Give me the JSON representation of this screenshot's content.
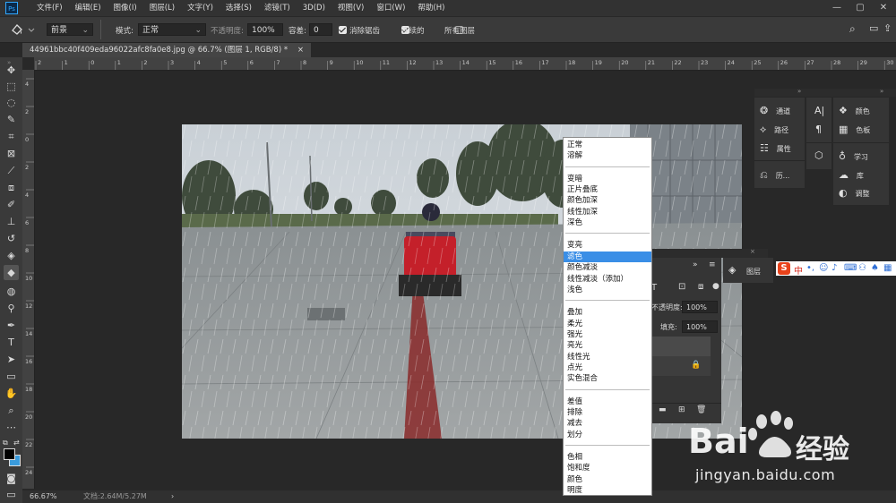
{
  "app": {
    "logo": "Ps",
    "menus": [
      "文件(F)",
      "编辑(E)",
      "图像(I)",
      "图层(L)",
      "文字(Y)",
      "选择(S)",
      "滤镜(T)",
      "3D(D)",
      "视图(V)",
      "窗口(W)",
      "帮助(H)"
    ],
    "window_controls": [
      "—",
      "▢",
      "✕"
    ]
  },
  "options_bar": {
    "fill_source": "前景",
    "mode_label": "模式:",
    "mode_value": "正常",
    "opacity_label": "不透明度:",
    "opacity_value": "100%",
    "tolerance_label": "容差:",
    "tolerance_value": "0",
    "antialias_label": "消除锯齿",
    "antialias_checked": true,
    "contiguous_label": "连续的",
    "contiguous_checked": true,
    "all_layers_label": "所有图层",
    "all_layers_checked": false
  },
  "document_tab": {
    "title": "44961bbc40f409eda96022afc8fa0e8.jpg @ 66.7% (图层 1, RGB/8) *",
    "close": "×"
  },
  "ruler": {
    "top_ticks": [
      "2",
      "1",
      "0",
      "1",
      "2",
      "3",
      "4",
      "5",
      "6",
      "7",
      "8",
      "9",
      "10",
      "11",
      "12",
      "13",
      "14",
      "15",
      "16",
      "17",
      "18",
      "19",
      "20",
      "21",
      "22",
      "23",
      "24",
      "25",
      "26",
      "27",
      "28",
      "29",
      "30"
    ],
    "left_ticks": [
      "4",
      "2",
      "0",
      "2",
      "4",
      "6",
      "8",
      "10",
      "12",
      "14",
      "16",
      "18",
      "20",
      "22",
      "24"
    ]
  },
  "status_bar": {
    "zoom": "66.67%",
    "doc_info": "文档:2.64M/5.27M",
    "arrow": "›"
  },
  "panel_groups": {
    "group1": [
      {
        "icon": "channels-icon",
        "label": "通道"
      },
      {
        "icon": "paths-icon",
        "label": "路径"
      },
      {
        "icon": "properties-icon",
        "label": "属性"
      },
      {
        "icon": "history-icon",
        "label": "历..."
      }
    ],
    "group2_icons": [
      "character-icon",
      "paragraph-icon",
      "3d-icon"
    ],
    "group3": [
      {
        "icon": "color-icon",
        "label": "颜色"
      },
      {
        "icon": "swatches-icon",
        "label": "色板"
      },
      {
        "icon": "learn-icon",
        "label": "学习"
      },
      {
        "icon": "libraries-icon",
        "label": "库"
      },
      {
        "icon": "adjustments-icon",
        "label": "调整"
      }
    ],
    "layers_tab_label": "图层"
  },
  "layers_panel": {
    "opacity_label": "不透明度:",
    "opacity_value": "100%",
    "fill_label": "填充:",
    "fill_value": "100%",
    "collapse": "»"
  },
  "blend_menu": {
    "groups": [
      [
        "正常",
        "溶解"
      ],
      [
        "变暗",
        "正片叠底",
        "颜色加深",
        "线性加深",
        "深色"
      ],
      [
        "变亮",
        "滤色",
        "颜色减淡",
        "线性减淡（添加）",
        "浅色"
      ],
      [
        "叠加",
        "柔光",
        "强光",
        "亮光",
        "线性光",
        "点光",
        "实色混合"
      ],
      [
        "差值",
        "排除",
        "减去",
        "划分"
      ],
      [
        "色相",
        "饱和度",
        "颜色",
        "明度"
      ]
    ],
    "selected": "滤色"
  },
  "ime_bar": {
    "logo": "S",
    "label": "中"
  },
  "watermark": {
    "brand": "Bai",
    "brand2": "经验",
    "url": "jingyan.baidu.com"
  },
  "colors": {
    "accent": "#31a8ff",
    "selection": "#3a8ee6",
    "ui_dark": "#282828",
    "panel": "#353535"
  }
}
